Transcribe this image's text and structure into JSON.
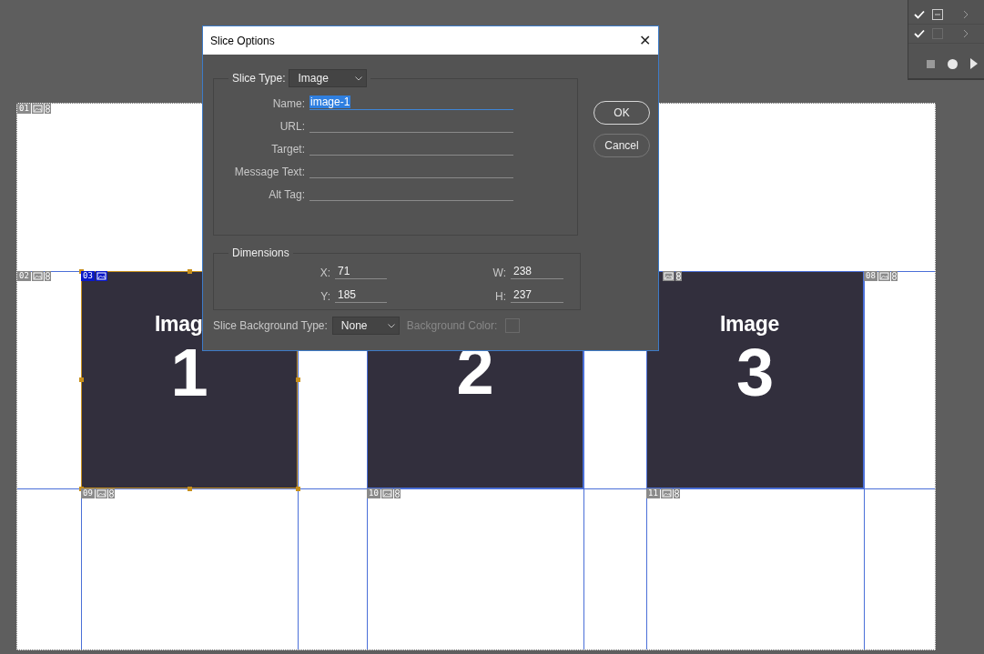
{
  "panel": {
    "rows": [
      {
        "visible": true,
        "kind": "group"
      },
      {
        "visible": true,
        "kind": "layer"
      }
    ]
  },
  "canvas": {
    "slices": [
      {
        "number": "01",
        "selected": false
      },
      {
        "number": "02",
        "selected": false
      },
      {
        "number": "03",
        "selected": true
      },
      {
        "selected": false
      },
      {
        "number": "08",
        "selected": false
      },
      {
        "number": "09",
        "selected": false
      },
      {
        "number": "10",
        "selected": false
      },
      {
        "number": "11",
        "selected": false
      }
    ],
    "images": [
      {
        "title": "Imag",
        "number": "1",
        "selected": true
      },
      {
        "number": "2",
        "selected": false
      },
      {
        "title": "Image",
        "number": "3",
        "selected": false
      }
    ]
  },
  "dialog": {
    "title": "Slice Options",
    "close": "✕",
    "slice_type": {
      "label": "Slice Type:",
      "value": "Image"
    },
    "fields": [
      {
        "label": "Name:",
        "value": "image-1",
        "selected": true
      },
      {
        "label": "URL:",
        "selected": false
      },
      {
        "label": "Target:",
        "selected": false
      },
      {
        "label": "Message Text:",
        "selected": false
      },
      {
        "label": "Alt Tag:",
        "selected": false
      }
    ],
    "dimensions": {
      "legend": "Dimensions",
      "fields": [
        {
          "label": "X:",
          "value": "71"
        },
        {
          "label": "W:",
          "value": "238"
        },
        {
          "label": "Y:",
          "value": "185"
        },
        {
          "label": "H:",
          "value": "237"
        }
      ]
    },
    "background": {
      "label": "Slice Background Type:",
      "value": "None",
      "color_label": "Background Color:",
      "disabled": true
    },
    "buttons": [
      {
        "label": "OK",
        "default": true
      },
      {
        "label": "Cancel",
        "default": false
      }
    ]
  }
}
